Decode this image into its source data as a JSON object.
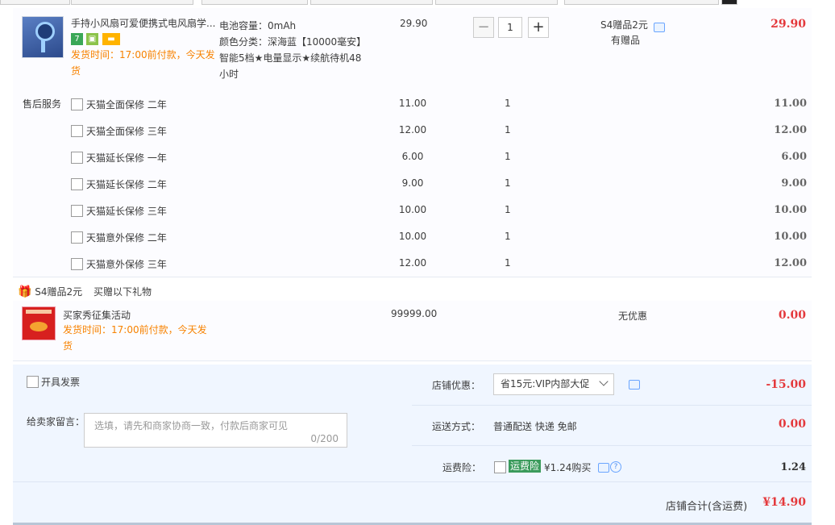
{
  "item": {
    "title": "手持小风扇可爱便携式电风扇学...",
    "badge_seven": "7",
    "ship_time": "发货时间：17:00前付款，今天发货",
    "sku_line1": "电池容量：0mAh",
    "sku_line2": "颜色分类：深海蓝【10000毫安】智能5档★电量显示★续航待机48小时",
    "price": "29.90",
    "quantity": "1",
    "gift_label": "S4赠品2元",
    "has_gift": "有赠品",
    "total": "29.90"
  },
  "services": {
    "label": "售后服务",
    "rows": [
      {
        "name": "天猫全面保修 二年",
        "price": "11.00",
        "qty": "1",
        "total": "11.00"
      },
      {
        "name": "天猫全面保修 三年",
        "price": "12.00",
        "qty": "1",
        "total": "12.00"
      },
      {
        "name": "天猫延长保修 一年",
        "price": "6.00",
        "qty": "1",
        "total": "6.00"
      },
      {
        "name": "天猫延长保修 二年",
        "price": "9.00",
        "qty": "1",
        "total": "9.00"
      },
      {
        "name": "天猫延长保修 三年",
        "price": "10.00",
        "qty": "1",
        "total": "10.00"
      },
      {
        "name": "天猫意外保修 二年",
        "price": "10.00",
        "qty": "1",
        "total": "10.00"
      },
      {
        "name": "天猫意外保修 三年",
        "price": "12.00",
        "qty": "1",
        "total": "12.00"
      }
    ]
  },
  "gift": {
    "head_label": "S4赠品2元",
    "head_note": "买赠以下礼物",
    "title": "买家秀征集活动",
    "ship_time": "发货时间：17:00前付款，今天发货",
    "price": "99999.00",
    "discount": "无优惠",
    "total": "0.00"
  },
  "order": {
    "invoice_label": "开具发票",
    "message_label": "给卖家留言：",
    "message_placeholder": "选填，请先和商家协商一致，付款后商家可见",
    "message_count": "0/200",
    "shop_discount_label": "店铺优惠：",
    "shop_discount_value": "省15元:VIP内部大促",
    "shop_discount_amount": "-15.00",
    "shipping_label": "运送方式：",
    "shipping_value": "普通配送 快递 免邮",
    "shipping_amount": "0.00",
    "insurance_label": "运费险：",
    "insurance_badge": "运费险",
    "insurance_price": "¥1.24购买",
    "insurance_amount": "1.24",
    "store_total_label": "店铺合计(含运费)",
    "store_total_value": "¥14.90"
  },
  "icons": {
    "chat": "chat-bubble-icon",
    "help": "question-circle-icon",
    "gift": "gift-icon",
    "fan": "fan-product-thumbnail"
  },
  "colors": {
    "price_red": "#e4393c",
    "ship_orange": "#f78200",
    "panel_bg": "#f0f6ff",
    "badge_green": "#3b9b5c"
  }
}
